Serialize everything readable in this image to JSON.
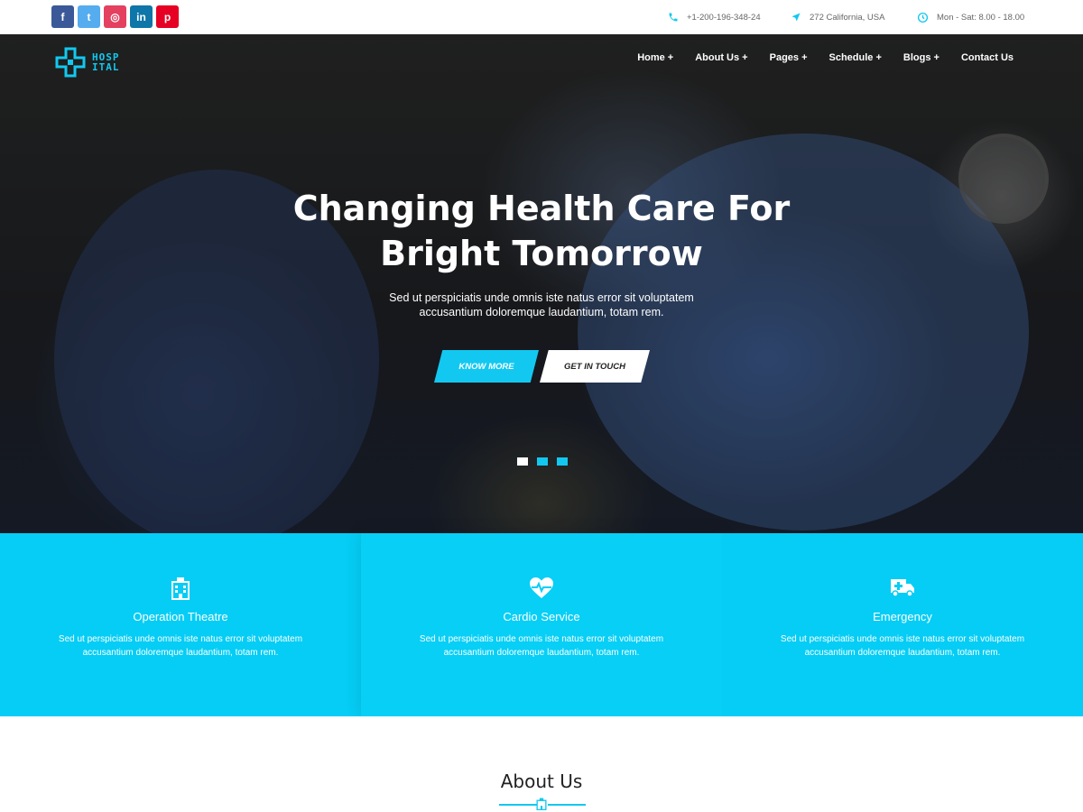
{
  "topbar": {
    "socials": [
      {
        "name": "facebook",
        "glyph": "f",
        "color": "#3b5998"
      },
      {
        "name": "twitter",
        "glyph": "t",
        "color": "#55acee"
      },
      {
        "name": "instagram",
        "glyph": "◎",
        "color": "#e4405f"
      },
      {
        "name": "linkedin",
        "glyph": "in",
        "color": "#0e76a8"
      },
      {
        "name": "pinterest",
        "glyph": "p",
        "color": "#e60023"
      }
    ],
    "phone": "+1-200-196-348-24",
    "address": "272 California, USA",
    "hours": "Mon - Sat: 8.00 - 18.00"
  },
  "brand": {
    "line1": "HOSP",
    "line2": "ITAL",
    "accent": "#12c8f0"
  },
  "nav": {
    "items": [
      "Home +",
      "About Us +",
      "Pages +",
      "Schedule +",
      "Blogs +",
      "Contact Us"
    ]
  },
  "hero": {
    "title_line1": "Changing Health Care For",
    "title_line2": "Bright Tomorrow",
    "subtitle_line1": "Sed ut perspiciatis unde omnis iste natus error sit voluptatem",
    "subtitle_line2": "accusantium doloremque laudantium, totam rem.",
    "primary_button": "KNOW MORE",
    "secondary_button": "GET IN TOUCH",
    "slides_total": 3,
    "active_slide": 1
  },
  "services": [
    {
      "icon": "hospital-building-icon",
      "title": "Operation Theatre",
      "desc_line1": "Sed ut perspiciatis unde omnis iste natus error sit voluptatem",
      "desc_line2": "accusantium doloremque laudantium, totam rem."
    },
    {
      "icon": "heartbeat-icon",
      "title": "Cardio Service",
      "desc_line1": "Sed ut perspiciatis unde omnis iste natus error sit voluptatem",
      "desc_line2": "accusantium doloremque laudantium, totam rem."
    },
    {
      "icon": "ambulance-icon",
      "title": "Emergency",
      "desc_line1": "Sed ut perspiciatis unde omnis iste natus error sit voluptatem",
      "desc_line2": "accusantium doloremque laudantium, totam rem."
    }
  ],
  "about": {
    "title": "About Us"
  },
  "colors": {
    "accent": "#12c8f0",
    "service_bg": "#05cdf5"
  }
}
